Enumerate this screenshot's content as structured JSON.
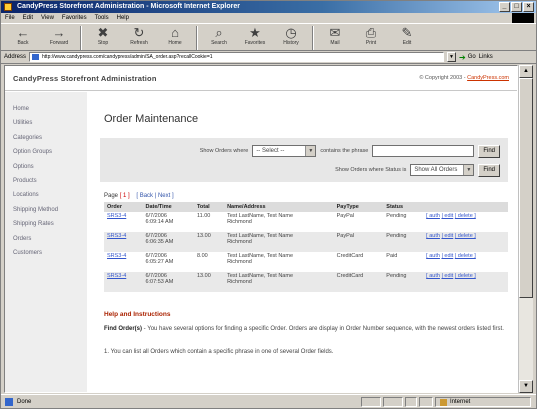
{
  "window": {
    "title": "CandyPress Storefront Administration - Microsoft Internet Explorer"
  },
  "menu": [
    "File",
    "Edit",
    "View",
    "Favorites",
    "Tools",
    "Help"
  ],
  "toolbar": {
    "buttons": [
      {
        "label": "Back",
        "icon": "back-arrow-icon",
        "glyph": "←"
      },
      {
        "label": "Forward",
        "icon": "forward-arrow-icon",
        "glyph": "→"
      },
      {
        "label": "Stop",
        "icon": "stop-icon",
        "glyph": "✖"
      },
      {
        "label": "Refresh",
        "icon": "refresh-icon",
        "glyph": "↻"
      },
      {
        "label": "Home",
        "icon": "home-icon",
        "glyph": "⌂"
      },
      {
        "label": "Search",
        "icon": "search-icon",
        "glyph": "⌕"
      },
      {
        "label": "Favorites",
        "icon": "favorites-icon",
        "glyph": "★"
      },
      {
        "label": "History",
        "icon": "history-icon",
        "glyph": "◷"
      },
      {
        "label": "Mail",
        "icon": "mail-icon",
        "glyph": "✉"
      },
      {
        "label": "Print",
        "icon": "print-icon",
        "glyph": "⎙"
      },
      {
        "label": "Edit",
        "icon": "edit-icon",
        "glyph": "✎"
      }
    ]
  },
  "address": {
    "label": "Address",
    "url": "http://www.candypress.com/candypress/admin/SA_order.asp?recallCookie=1",
    "go_label": "Go",
    "links_label": "Links"
  },
  "header": {
    "brand": "CandyPress Storefront Administration",
    "copyright": "© Copyright 2003 - ",
    "copyright_link": "CandyPress.com"
  },
  "nav": [
    "Home",
    "Utilities",
    "Categories",
    "Option Groups",
    "Options",
    "Products",
    "Locations",
    "Shipping Method",
    "Shipping Rates",
    "Orders",
    "Customers"
  ],
  "page": {
    "title": "Order Maintenance"
  },
  "filter": {
    "show_label": "Show Orders where",
    "select_value": "-- Select --",
    "contains_label": "contains the phrase",
    "phrase_value": "",
    "find_label": "Find",
    "status_label": "Show Orders where Status is",
    "status_value": "Show All Orders",
    "find2_label": "Find"
  },
  "pager": {
    "page_label": "Page",
    "current": "[ 1 ]",
    "back": "[ Back |",
    "next": "Next ]"
  },
  "table": {
    "headers": [
      "Order",
      "Date/Time",
      "Total",
      "Name/Address",
      "PayType",
      "Status",
      ""
    ],
    "rows": [
      {
        "order": "SRS3-4",
        "date": "6/7/2006",
        "time": "6:09:14 AM",
        "total": "11.00",
        "name": "Test LastName, Test Name",
        "addr": "Richmond",
        "paytype": "PayPal",
        "status": "Pending"
      },
      {
        "order": "SRS3-4",
        "date": "6/7/2006",
        "time": "6:06:35 AM",
        "total": "13.00",
        "name": "Test LastName, Test Name",
        "addr": "Richmond",
        "paytype": "PayPal",
        "status": "Pending"
      },
      {
        "order": "SRS3-4",
        "date": "6/7/2006",
        "time": "6:05:27 AM",
        "total": "8.00",
        "name": "Test LastName, Test Name",
        "addr": "Richmond",
        "paytype": "CreditCard",
        "status": "Paid"
      },
      {
        "order": "SRS3-4",
        "date": "6/7/2006",
        "time": "6:07:53 AM",
        "total": "13.00",
        "name": "Test LastName, Test Name",
        "addr": "Richmond",
        "paytype": "CreditCard",
        "status": "Pending"
      }
    ],
    "actions": [
      "[ auth",
      "| edit",
      "| delete ]"
    ]
  },
  "help": {
    "title": "Help and Instructions",
    "p1_bold": "Find Order(s)",
    "p1": " - You have several options for finding a specific Order. Orders are display in Order Number sequence, with the newest orders listed first.",
    "p2": "1. You can list all Orders which contain a specific phrase in one of several Order fields."
  },
  "status": {
    "text": "Done",
    "zone": "Internet"
  }
}
